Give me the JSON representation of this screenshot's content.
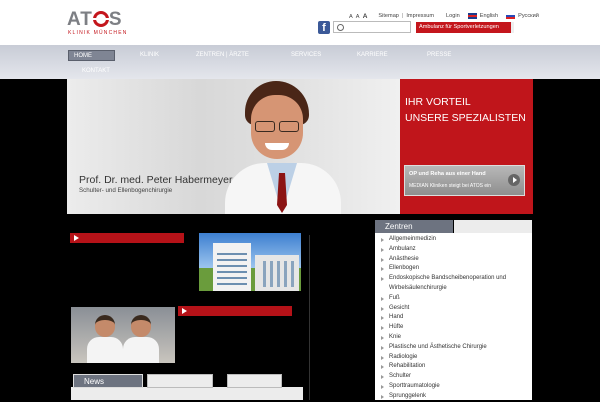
{
  "logo": {
    "word_left": "AT",
    "word_right": "S",
    "subtitle": "KLINIK MÜNCHEN"
  },
  "topnav": {
    "font_sizes": [
      "A",
      "A",
      "A"
    ],
    "sitemap": "Sitemap",
    "impressum": "Impressum",
    "login": "Login",
    "english": "English",
    "russian": "Русский"
  },
  "header": {
    "facebook_label": "f",
    "search_placeholder": "",
    "ambulanz_label": "Ambulanz für Sportverletzungen"
  },
  "nav": {
    "items": [
      "HOME",
      "KLINIK",
      "ZENTREN | ÄRZTE",
      "SERVICES",
      "KARRIERE",
      "PRESSE",
      "KONTAKT"
    ],
    "active": "HOME"
  },
  "hero": {
    "name": "Prof. Dr. med. Peter Habermeyer",
    "role": "Schulter- und Ellenbogenchirurgie",
    "headline_1": "IHR VORTEIL",
    "headline_2": "UNSERE SPEZIALISTEN",
    "promo_title": "OP und Reha aus einer Hand",
    "promo_text": "MEDIAN Kliniken steigt bei ATOS ein"
  },
  "tabs": {
    "news": "News"
  },
  "sidebar": {
    "tab_active": "Zentren",
    "items": [
      "Allgemeinmedizin",
      "Ambulanz",
      "Anästhesie",
      "Ellenbogen",
      "Endoskopische Bandscheibenoperation und",
      "Wirbelsäulenchirurgie",
      "Fuß",
      "Gesicht",
      "Hand",
      "Hüfte",
      "Knie",
      "Plastische und Ästhetische Chirurgie",
      "Radiologie",
      "Rehabilitation",
      "Schulter",
      "Sporttraumatologie",
      "Sprunggelenk"
    ]
  },
  "colors": {
    "brand_red": "#c0151b",
    "nav_active": "#7f8594",
    "background": "#000000"
  }
}
